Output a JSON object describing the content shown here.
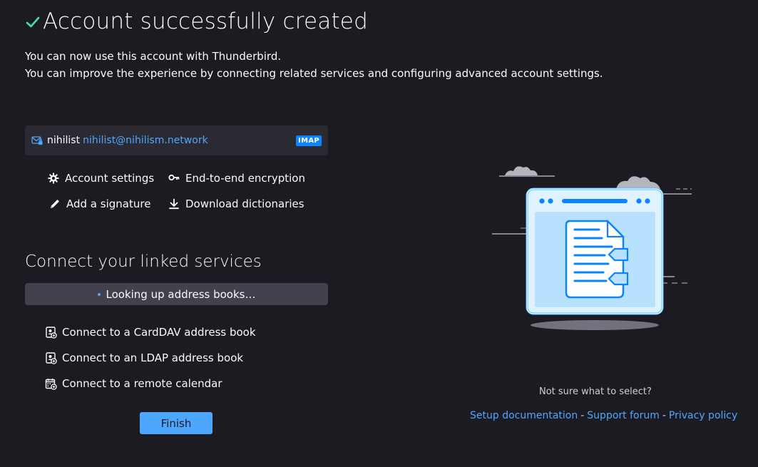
{
  "header": {
    "title": "Account successfully created",
    "intro_line1": "You can now use this account with Thunderbird.",
    "intro_line2": "You can improve the experience by connecting related services and configuring advanced account settings."
  },
  "account": {
    "name": "nihilist",
    "email": "nihilist@nihilism.network",
    "protocol": "IMAP",
    "icon": "mail-lock-icon"
  },
  "actions": [
    {
      "label": "Account settings",
      "icon": "gear-icon"
    },
    {
      "label": "End-to-end encryption",
      "icon": "key-icon"
    },
    {
      "label": "Add a signature",
      "icon": "pen-icon"
    },
    {
      "label": "Download dictionaries",
      "icon": "download-icon"
    }
  ],
  "linked": {
    "title": "Connect your linked services",
    "status": "Looking up address books…",
    "items": [
      {
        "label": "Connect to a CardDAV address book",
        "icon": "address-book-add-icon"
      },
      {
        "label": "Connect to an LDAP address book",
        "icon": "address-book-add-icon"
      },
      {
        "label": "Connect to a remote calendar",
        "icon": "calendar-add-icon"
      }
    ]
  },
  "finish_label": "Finish",
  "help": {
    "question": "Not sure what to select?",
    "links": [
      "Setup documentation",
      "Support forum",
      "Privacy policy"
    ],
    "separator": "-"
  },
  "colors": {
    "background": "#1c1b22",
    "card": "#2b2a33",
    "accent": "#4ea7ff",
    "success": "#3fe1b0",
    "badge": "#0a84ff"
  }
}
